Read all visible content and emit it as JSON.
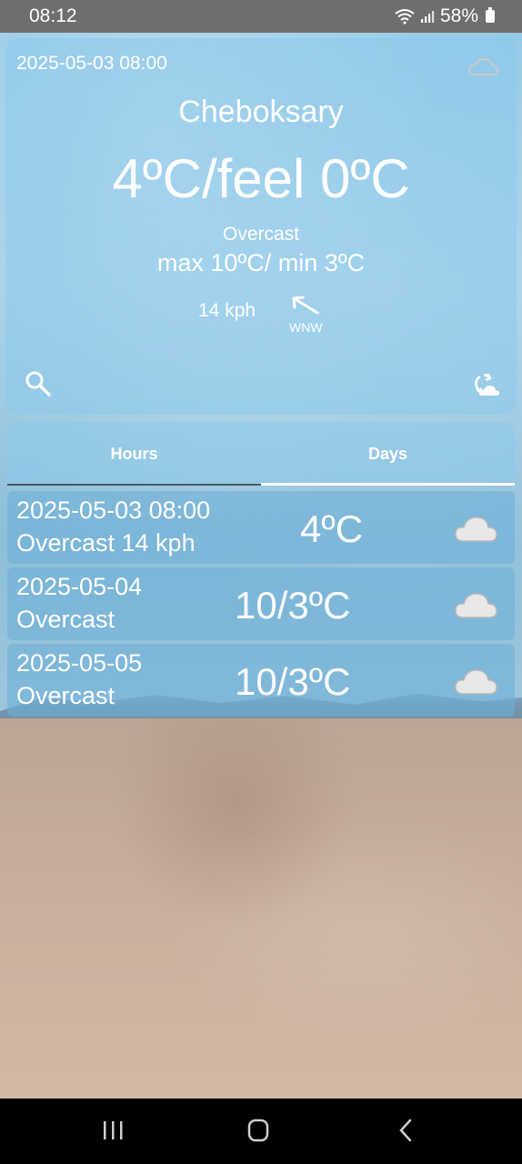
{
  "status_bar": {
    "time": "08:12",
    "battery": "58%"
  },
  "current": {
    "datetime": "2025-05-03 08:00",
    "city": "Cheboksary",
    "temperature": "4ºC/feel 0ºC",
    "condition": "Overcast",
    "max_min": "max 10ºC/ min 3ºC",
    "wind_speed": "14 kph",
    "wind_direction": "WNW",
    "icon": "cloud-icon"
  },
  "tabs": [
    {
      "label": "Hours",
      "selected": false
    },
    {
      "label": "Days",
      "selected": true
    }
  ],
  "forecast": [
    {
      "line1": "2025-05-03 08:00",
      "line2": "Overcast  14 kph",
      "temp": "4ºC",
      "icon": "cloud-icon"
    },
    {
      "line1": "2025-05-04",
      "line2": "Overcast",
      "temp": "10/3ºC",
      "icon": "cloud-icon"
    },
    {
      "line1": "2025-05-05",
      "line2": "Overcast",
      "temp": "10/3ºC",
      "icon": "cloud-icon"
    }
  ],
  "colors": {
    "card": "#8cc8eb",
    "text": "#ffffff",
    "status_bar": "#6e6e6e",
    "nav_bar": "#000000"
  }
}
